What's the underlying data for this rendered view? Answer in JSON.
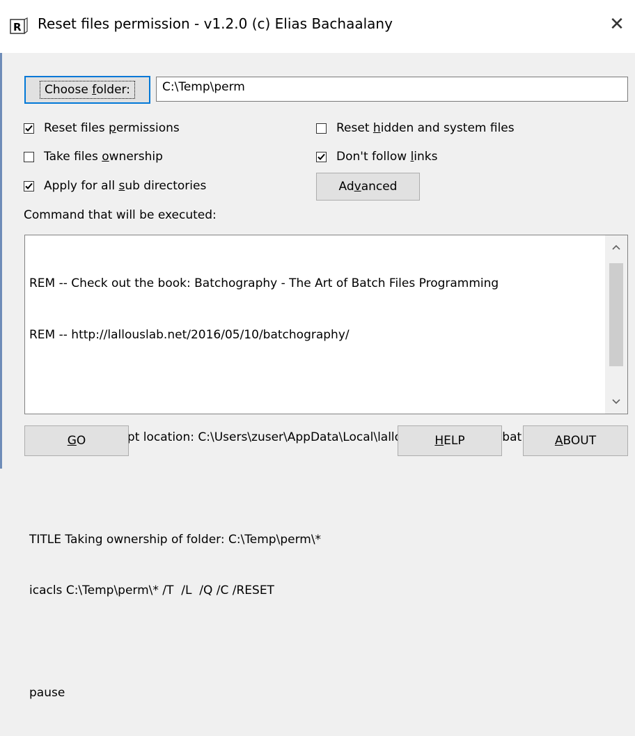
{
  "window": {
    "title": "Reset files permission - v1.2.0 (c) Elias Bachaalany",
    "icon": "app-r-icon",
    "close_glyph": "✕"
  },
  "folder": {
    "choose_label_pre": "Choose ",
    "choose_label_key": "f",
    "choose_label_post": "older:",
    "path": "C:\\Temp\\perm"
  },
  "options": {
    "reset_perms": {
      "pre": "Reset files ",
      "key": "p",
      "post": "ermissions",
      "checked": true
    },
    "take_owner": {
      "pre": "Take files ",
      "key": "o",
      "post": "wnership",
      "checked": false
    },
    "apply_sub": {
      "pre": "Apply for all ",
      "key": "s",
      "post": "ub directories",
      "checked": true
    },
    "reset_hidden": {
      "pre": "Reset ",
      "key": "h",
      "post": "idden and system files",
      "checked": false
    },
    "dont_follow": {
      "pre": "Don't follow ",
      "key": "l",
      "post": "inks",
      "checked": true
    }
  },
  "advanced": {
    "pre": "Ad",
    "key": "v",
    "post": "anced"
  },
  "command_label": "Command that will be executed:",
  "command_lines": [
    "REM -- Check out the book: Batchography - The Art of Batch Files Programming",
    "REM -- http://lallouslab.net/2016/05/10/batchography/",
    "",
    "REM -- Temp script location: C:\\Users\\zuser\\AppData\\Local\\lallouslab\\resetperm.bat",
    "",
    "TITLE Taking ownership of folder: C:\\Temp\\perm\\*",
    "icacls C:\\Temp\\perm\\* /T  /L  /Q /C /RESET",
    "",
    "pause"
  ],
  "buttons": {
    "go": {
      "key": "G",
      "post": "O"
    },
    "help": {
      "key": "H",
      "post": "ELP"
    },
    "about": {
      "key": "A",
      "post": "BOUT"
    }
  }
}
